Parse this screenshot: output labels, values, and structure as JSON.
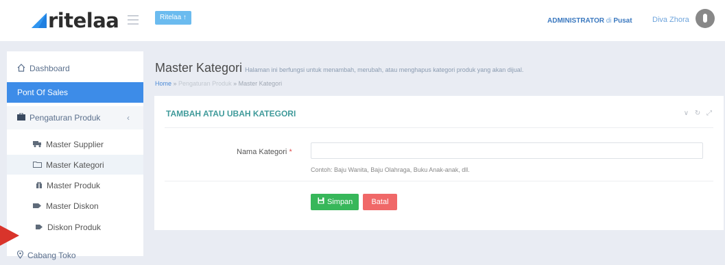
{
  "header": {
    "logo_text": "ritelaa",
    "brand_button": "Ritelaa ↑",
    "role": "ADMINISTRATOR",
    "role_sep": "di",
    "location": "Pusat",
    "username": "Diva Zhora"
  },
  "sidebar": {
    "items": [
      {
        "label": "Dashboard",
        "icon": "home-icon"
      },
      {
        "label": "Pont Of Sales"
      },
      {
        "label": "Pengaturan Produk",
        "icon": "briefcase-icon",
        "chevron": "‹"
      },
      {
        "label": "Master Supplier",
        "icon": "truck-icon"
      },
      {
        "label": "Master Kategori",
        "icon": "folder-icon"
      },
      {
        "label": "Master Produk",
        "icon": "gift-icon"
      },
      {
        "label": "Master Diskon",
        "icon": "tag-icon"
      },
      {
        "label": "Diskon Produk",
        "icon": "tag-icon"
      },
      {
        "label": "Cabang Toko",
        "icon": "map-pin-icon"
      }
    ]
  },
  "page": {
    "title": "Master Kategori",
    "description": "Halaman ini berfungsi untuk menambah, merubah, atau menghapus kategori produk yang akan dijual.",
    "breadcrumb": {
      "home": "Home",
      "sep1": " » ",
      "mid": "Pengaturan Produk",
      "sep2": " » ",
      "current": "Master Kategori"
    }
  },
  "panel": {
    "title": "TAMBAH ATAU UBAH KATEGORI",
    "tools": "∨ ↻ ⤢",
    "field_label": "Nama Kategori",
    "required_mark": "*",
    "field_value": "",
    "hint": "Contoh: Baju Wanita, Baju Olahraga, Buku Anak-anak, dll.",
    "save_label": "Simpan",
    "cancel_label": "Batal"
  },
  "colors": {
    "accent": "#3d8ce8",
    "save": "#37b75a",
    "cancel": "#f06868",
    "panel_title": "#3f9a9a"
  }
}
